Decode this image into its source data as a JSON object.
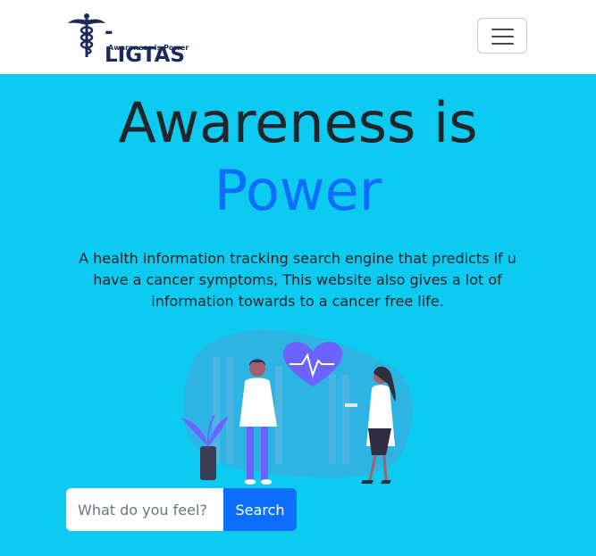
{
  "navbar": {
    "brand_name": "-LIGTAS",
    "brand_tagline": "Awareness is Power",
    "toggler_icon": "hamburger-menu-icon"
  },
  "hero": {
    "title_line1": "Awareness is",
    "title_line2": "Power",
    "description": "A health information tracking search engine that predicts if u have a cancer symptoms, This website also gives a lot of information towards to a cancer free life."
  },
  "search": {
    "placeholder": "What do you feel?",
    "value": "",
    "button_label": "Search"
  },
  "colors": {
    "background": "#0dcaf0",
    "accent": "#0d6efd",
    "navbar": "#ffffff",
    "brand": "#1b2a59"
  }
}
